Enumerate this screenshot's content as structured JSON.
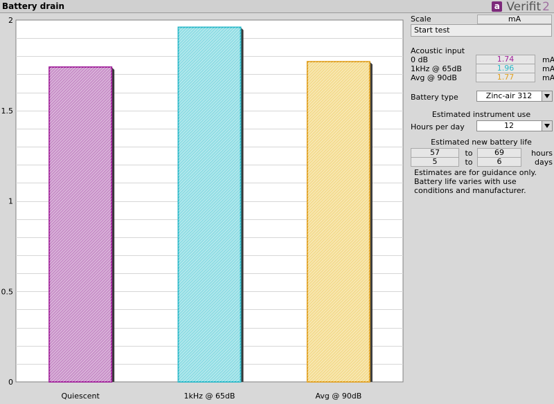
{
  "app": {
    "title": "Battery drain",
    "brand_name": "Verifit",
    "brand_version": "2",
    "brand_logo_letter": "a"
  },
  "panel": {
    "scale_label": "Scale",
    "scale_value": "mA",
    "start_button": "Start test",
    "acoustic_title": "Acoustic input",
    "acoustic_rows": [
      {
        "label": "0 dB",
        "value": "1.74",
        "unit": "mA",
        "color": "#a0209a"
      },
      {
        "label": "1kHz @ 65dB",
        "value": "1.96",
        "unit": "mA",
        "color": "#28b8c8"
      },
      {
        "label": "Avg @ 90dB",
        "value": "1.77",
        "unit": "mA",
        "color": "#e0a020"
      }
    ],
    "battery_type_label": "Battery type",
    "battery_type_value": "Zinc-air 312",
    "usage_title": "Estimated instrument use",
    "hours_label": "Hours per day",
    "hours_value": "12",
    "life_title": "Estimated new battery life",
    "life_rows": [
      {
        "from": "57",
        "to_label": "to",
        "to": "69",
        "unit": "hours"
      },
      {
        "from": "5",
        "to_label": "to",
        "to": "6",
        "unit": "days"
      }
    ],
    "note": "Estimates are for guidance only.  Battery life varies with use conditions and manufacturer."
  },
  "chart_data": {
    "type": "bar",
    "categories": [
      "Quiescent",
      "1kHz @ 65dB",
      "Avg @ 90dB"
    ],
    "values": [
      1.74,
      1.96,
      1.77
    ],
    "colors": [
      "#c890c8",
      "#90dde4",
      "#f4dc90"
    ],
    "edge_colors": [
      "#a0209a",
      "#28b8c8",
      "#e0a020"
    ],
    "ylim": [
      0,
      2
    ],
    "yticks": [
      "0",
      "0.5",
      "1",
      "1.5",
      "2"
    ],
    "ytick_values": [
      0,
      0.5,
      1,
      1.5,
      2
    ],
    "grid": true,
    "legend": "none"
  }
}
